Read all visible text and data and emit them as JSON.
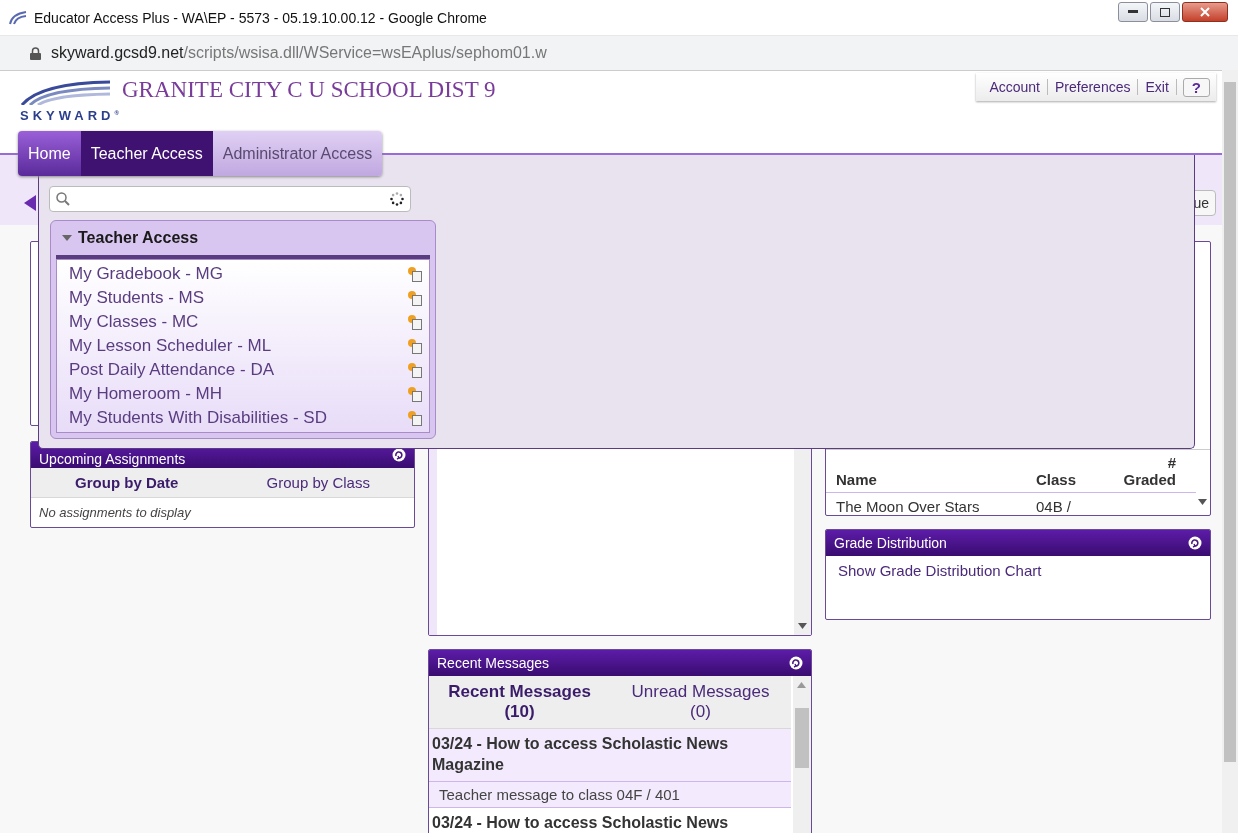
{
  "window": {
    "title": "Educator Access Plus - WA\\EP - 5573 - 05.19.10.00.12 - Google Chrome"
  },
  "address_bar": {
    "domain": "skyward.gcsd9.net",
    "path": "/scripts/wsisa.dll/WService=wsEAplus/sephom01.w"
  },
  "header": {
    "logo_text": "SKYWARD$^{®}$",
    "district": "GRANITE CITY C U SCHOOL DIST 9",
    "links": [
      "Account",
      "Preferences",
      "Exit",
      "?"
    ]
  },
  "nav_tabs": [
    {
      "label": "Home",
      "selected": false
    },
    {
      "label": "Teacher Access",
      "selected": true
    },
    {
      "label": "Administrator Access",
      "selected": false
    }
  ],
  "menu": {
    "group": {
      "title": "Teacher Access",
      "expanded": true,
      "items": [
        "My Gradebook - MG",
        "My Students - MS",
        "My Classes - MC",
        "My Lesson Scheduler - ML",
        "Post Daily Attendance - DA",
        "My Homeroom - MH",
        "My Students With Disabilities - SD"
      ]
    }
  },
  "partial_button": "ue",
  "upcoming": {
    "title": "Upcoming Assignments",
    "tabs": [
      {
        "label": "Group by Date",
        "selected": true
      },
      {
        "label": "Group by Class",
        "selected": false
      }
    ],
    "empty": "No assignments to display"
  },
  "grading": {
    "columns": [
      "Name",
      "Class",
      "# Graded"
    ],
    "rows": [
      [
        "The Moon Over Stars",
        "04B /"
      ]
    ]
  },
  "grade_distribution": {
    "title": "Grade Distribution",
    "link": "Show Grade Distribution Chart"
  },
  "messages": {
    "title": "Recent Messages",
    "tabs": [
      {
        "label": "Recent Messages (10)",
        "selected": true
      },
      {
        "label": "Unread Messages (0)",
        "selected": false
      }
    ],
    "items": [
      {
        "title": "03/24 - How to access Scholastic News Magazine",
        "detail": "Teacher message to class 04F / 401"
      },
      {
        "title": "03/24 - How to access Scholastic News"
      }
    ]
  }
}
